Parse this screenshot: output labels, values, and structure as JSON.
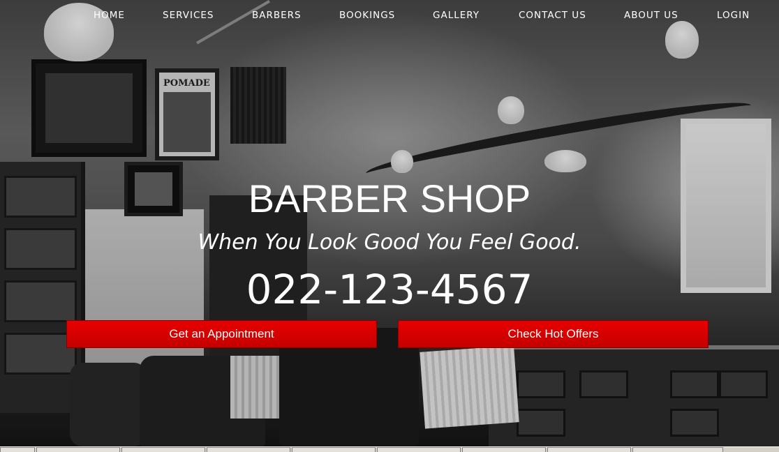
{
  "nav": {
    "items": [
      {
        "label": "HOME"
      },
      {
        "label": "SERVICES"
      },
      {
        "label": "BARBERS"
      },
      {
        "label": "BOOKINGS"
      },
      {
        "label": "GALLERY"
      },
      {
        "label": "CONTACT US"
      },
      {
        "label": "ABOUT US"
      },
      {
        "label": "LOGIN"
      }
    ]
  },
  "hero": {
    "title": "BARBER SHOP",
    "tagline": "When You Look Good You Feel Good.",
    "phone": "022-123-4567",
    "poster_text": "POMADE",
    "buttons": {
      "appointment": "Get an Appointment",
      "offers": "Check Hot Offers"
    }
  },
  "taskbar": {
    "items": [
      "",
      "",
      "",
      "",
      "",
      "",
      "",
      "",
      ""
    ]
  },
  "colors": {
    "button_red": "#d40000",
    "text": "#ffffff"
  }
}
